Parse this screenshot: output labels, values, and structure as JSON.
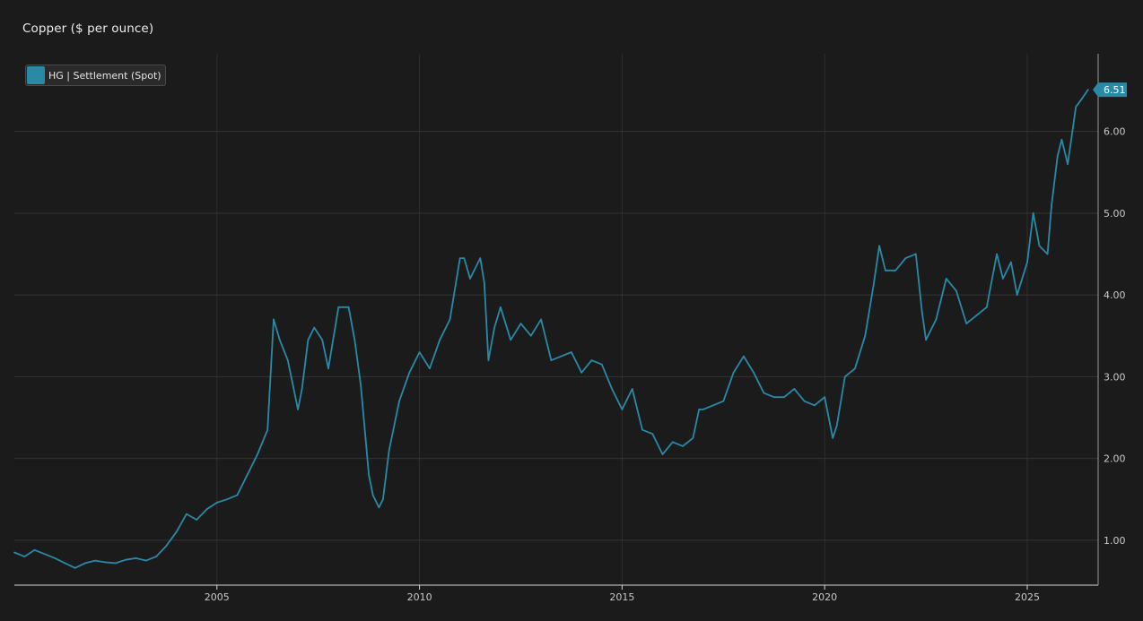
{
  "chart_data": {
    "type": "line",
    "title": "Copper ($ per ounce)",
    "legend": {
      "label": "HG | Settlement (Spot)",
      "position": "top-left"
    },
    "series": [
      {
        "name": "HG | Settlement (Spot)",
        "color": "#2a8aa6",
        "x": [
          2000.0,
          2000.25,
          2000.5,
          2000.75,
          2001.0,
          2001.25,
          2001.5,
          2001.75,
          2002.0,
          2002.25,
          2002.5,
          2002.75,
          2003.0,
          2003.25,
          2003.5,
          2003.75,
          2004.0,
          2004.25,
          2004.5,
          2004.75,
          2005.0,
          2005.25,
          2005.5,
          2005.75,
          2006.0,
          2006.25,
          2006.4,
          2006.55,
          2006.75,
          2007.0,
          2007.1,
          2007.25,
          2007.4,
          2007.6,
          2007.75,
          2008.0,
          2008.25,
          2008.4,
          2008.55,
          2008.75,
          2008.85,
          2009.0,
          2009.1,
          2009.25,
          2009.5,
          2009.75,
          2010.0,
          2010.25,
          2010.5,
          2010.75,
          2011.0,
          2011.1,
          2011.25,
          2011.5,
          2011.6,
          2011.7,
          2011.85,
          2012.0,
          2012.25,
          2012.5,
          2012.75,
          2013.0,
          2013.25,
          2013.5,
          2013.75,
          2014.0,
          2014.25,
          2014.5,
          2014.75,
          2015.0,
          2015.25,
          2015.5,
          2015.75,
          2016.0,
          2016.25,
          2016.5,
          2016.75,
          2016.9,
          2017.0,
          2017.25,
          2017.5,
          2017.75,
          2018.0,
          2018.25,
          2018.5,
          2018.75,
          2019.0,
          2019.25,
          2019.5,
          2019.75,
          2020.0,
          2020.2,
          2020.3,
          2020.5,
          2020.75,
          2021.0,
          2021.2,
          2021.35,
          2021.5,
          2021.75,
          2022.0,
          2022.25,
          2022.4,
          2022.5,
          2022.75,
          2023.0,
          2023.25,
          2023.5,
          2023.75,
          2024.0,
          2024.25,
          2024.4,
          2024.6,
          2024.75,
          2025.0,
          2025.15,
          2025.3,
          2025.5,
          2025.6,
          2025.75,
          2025.85,
          2026.0,
          2026.2,
          2026.35,
          2026.5
        ],
        "values": [
          0.85,
          0.8,
          0.88,
          0.83,
          0.78,
          0.72,
          0.66,
          0.72,
          0.75,
          0.73,
          0.72,
          0.76,
          0.78,
          0.75,
          0.8,
          0.93,
          1.1,
          1.32,
          1.25,
          1.38,
          1.46,
          1.5,
          1.55,
          1.8,
          2.05,
          2.35,
          3.7,
          3.45,
          3.2,
          2.6,
          2.85,
          3.45,
          3.6,
          3.45,
          3.1,
          3.85,
          3.85,
          3.45,
          2.9,
          1.8,
          1.55,
          1.4,
          1.5,
          2.1,
          2.7,
          3.05,
          3.3,
          3.1,
          3.45,
          3.7,
          4.45,
          4.45,
          4.2,
          4.45,
          4.15,
          3.2,
          3.6,
          3.85,
          3.45,
          3.65,
          3.5,
          3.7,
          3.2,
          3.25,
          3.3,
          3.05,
          3.2,
          3.15,
          2.85,
          2.6,
          2.85,
          2.35,
          2.3,
          2.05,
          2.2,
          2.15,
          2.25,
          2.6,
          2.6,
          2.65,
          2.7,
          3.05,
          3.25,
          3.05,
          2.8,
          2.75,
          2.75,
          2.85,
          2.7,
          2.65,
          2.75,
          2.25,
          2.4,
          3.0,
          3.1,
          3.5,
          4.1,
          4.6,
          4.3,
          4.3,
          4.45,
          4.5,
          3.8,
          3.45,
          3.7,
          4.2,
          4.05,
          3.65,
          3.75,
          3.85,
          4.5,
          4.2,
          4.4,
          4.0,
          4.4,
          5.0,
          4.6,
          4.5,
          5.1,
          5.7,
          5.9,
          5.6,
          6.3,
          6.4,
          6.51
        ]
      }
    ],
    "last_value_label": "6.51",
    "xlim": [
      2000.0,
      2026.75
    ],
    "ylim": [
      0.45,
      6.95
    ],
    "x_ticks": [
      2005,
      2010,
      2015,
      2020,
      2025
    ],
    "x_tick_labels": [
      "2005",
      "2010",
      "2015",
      "2020",
      "2025"
    ],
    "y_ticks": [
      1,
      2,
      3,
      4,
      5,
      6
    ],
    "y_tick_labels": [
      "1.00",
      "2.00",
      "3.00",
      "4.00",
      "5.00",
      "6.00"
    ],
    "grid": true
  }
}
